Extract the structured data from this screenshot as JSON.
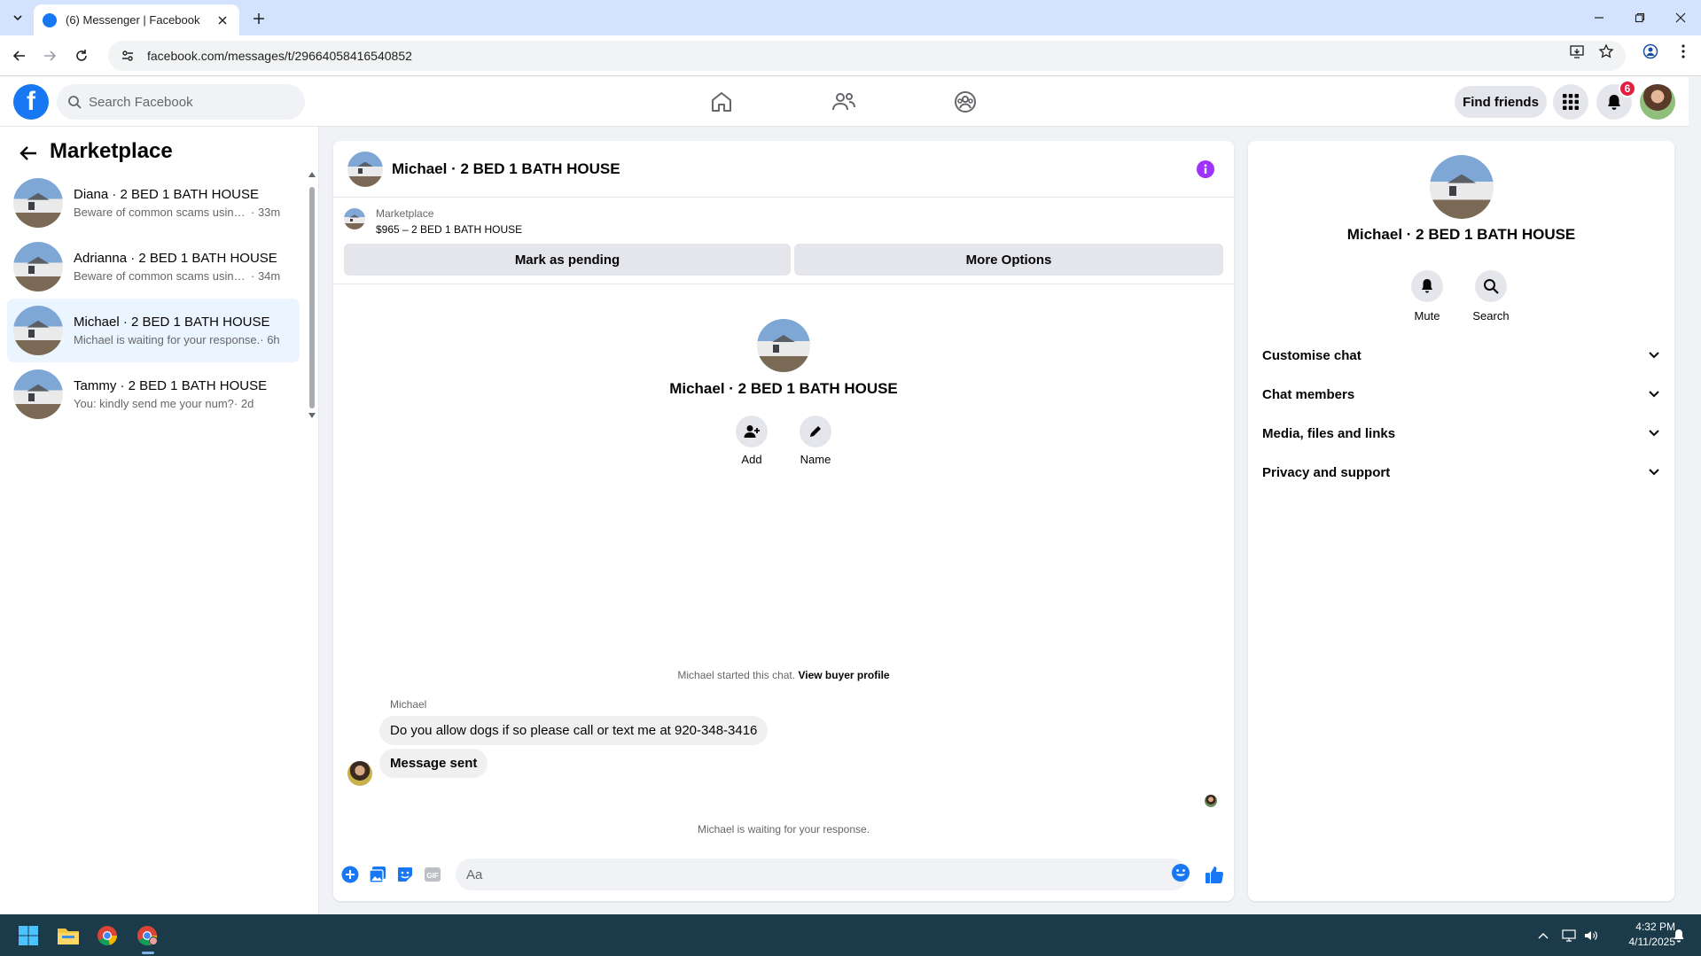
{
  "browser": {
    "tab_title": "(6) Messenger | Facebook",
    "url": "facebook.com/messages/t/29664058416540852"
  },
  "header": {
    "search_placeholder": "Search Facebook",
    "find_friends_label": "Find friends",
    "notification_count": "6"
  },
  "sidebar": {
    "title": "Marketplace",
    "items": [
      {
        "name": "Diana · 2 BED 1 BATH HOUSE",
        "preview": "Beware of common scams using ...",
        "time": " · 33m",
        "active": false
      },
      {
        "name": "Adrianna · 2 BED 1 BATH HOUSE",
        "preview": "Beware of common scams using ...",
        "time": " · 34m",
        "active": false
      },
      {
        "name": "Michael · 2 BED 1 BATH HOUSE",
        "preview": "Michael is waiting for your response.",
        "time": " · 6h",
        "active": true
      },
      {
        "name": "Tammy · 2 BED 1 BATH HOUSE",
        "preview": "You: kindly send me your num?",
        "time": " · 2d",
        "active": false
      }
    ]
  },
  "chat": {
    "title": "Michael · 2 BED 1 BATH HOUSE",
    "marketplace_label": "Marketplace",
    "listing": "$965 – 2 BED 1 BATH HOUSE",
    "mark_pending_label": "Mark as pending",
    "more_options_label": "More Options",
    "intro_name": "Michael · 2 BED 1 BATH HOUSE",
    "add_label": "Add",
    "name_label": "Name",
    "started_text": "Michael started this chat.",
    "view_profile_label": "View buyer profile",
    "sender_name": "Michael",
    "message_1": "Do you allow dogs if so please call or text me at 920-348-3416",
    "message_2": "Message sent",
    "waiting_text": "Michael is waiting for your response.",
    "composer_placeholder": "Aa"
  },
  "details": {
    "name": "Michael · 2 BED 1 BATH HOUSE",
    "mute_label": "Mute",
    "search_label": "Search",
    "sections": [
      "Customise chat",
      "Chat members",
      "Media, files and links",
      "Privacy and support"
    ]
  },
  "taskbar": {
    "time": "4:32 PM",
    "date": "4/11/2025"
  },
  "colors": {
    "fb_blue": "#1877f2",
    "messenger_purple": "#a033ff",
    "active_row": "#ebf5ff",
    "taskbar": "#1c3b4a",
    "tabbar": "#d3e3fd"
  }
}
